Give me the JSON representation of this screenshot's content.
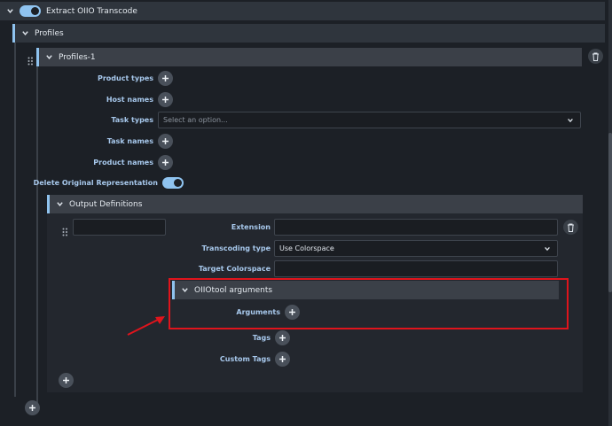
{
  "root_section": {
    "title": "Extract OIIO Transcode",
    "enabled": true
  },
  "profiles": {
    "title": "Profiles"
  },
  "profile_item": {
    "title": "Profiles-1"
  },
  "fields": {
    "product_types": "Product types",
    "host_names": "Host names",
    "task_types": "Task types",
    "task_types_placeholder": "Select an option...",
    "task_names": "Task names",
    "product_names": "Product names",
    "delete_original": "Delete Original Representation"
  },
  "output_definitions": {
    "title": "Output Definitions",
    "extension_label": "Extension",
    "transcoding_type_label": "Transcoding type",
    "transcoding_type_value": "Use Colorspace",
    "target_colorspace_label": "Target Colorspace",
    "oiio_args_title": "OIIOtool arguments",
    "arguments_label": "Arguments",
    "tags_label": "Tags",
    "custom_tags_label": "Custom Tags"
  },
  "colors": {
    "accent": "#8fc3ef",
    "highlight": "#e0141c"
  }
}
